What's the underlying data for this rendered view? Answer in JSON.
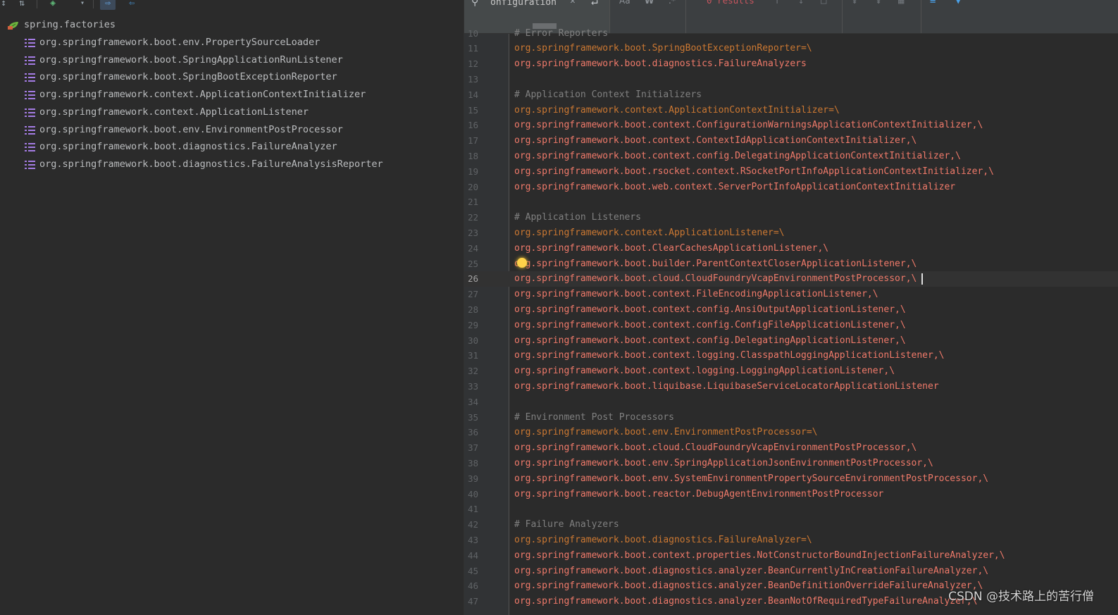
{
  "search": {
    "value": "onfiguration",
    "results": "0 results",
    "case_label": "Aa",
    "word_label": "W",
    "regex_label": ".*"
  },
  "tree": {
    "root": "spring.factories",
    "items": [
      "org.springframework.boot.env.PropertySourceLoader",
      "org.springframework.boot.SpringApplicationRunListener",
      "org.springframework.boot.SpringBootExceptionReporter",
      "org.springframework.context.ApplicationContextInitializer",
      "org.springframework.context.ApplicationListener",
      "org.springframework.boot.env.EnvironmentPostProcessor",
      "org.springframework.boot.diagnostics.FailureAnalyzer",
      "org.springframework.boot.diagnostics.FailureAnalysisReporter"
    ]
  },
  "editor": {
    "current_line": 26,
    "lines": [
      {
        "n": "10",
        "type": "comment",
        "text": "# Error Reporters"
      },
      {
        "n": "11",
        "type": "key",
        "text": "org.springframework.boot.SpringBootExceptionReporter=\\"
      },
      {
        "n": "12",
        "type": "value",
        "text": "org.springframework.boot.diagnostics.FailureAnalyzers"
      },
      {
        "n": "13",
        "type": "blank",
        "text": ""
      },
      {
        "n": "14",
        "type": "comment",
        "text": "# Application Context Initializers"
      },
      {
        "n": "15",
        "type": "key",
        "text": "org.springframework.context.ApplicationContextInitializer=\\"
      },
      {
        "n": "16",
        "type": "value",
        "text": "org.springframework.boot.context.ConfigurationWarningsApplicationContextInitializer,\\"
      },
      {
        "n": "17",
        "type": "value",
        "text": "org.springframework.boot.context.ContextIdApplicationContextInitializer,\\"
      },
      {
        "n": "18",
        "type": "value",
        "text": "org.springframework.boot.context.config.DelegatingApplicationContextInitializer,\\"
      },
      {
        "n": "19",
        "type": "value",
        "text": "org.springframework.boot.rsocket.context.RSocketPortInfoApplicationContextInitializer,\\"
      },
      {
        "n": "20",
        "type": "value",
        "text": "org.springframework.boot.web.context.ServerPortInfoApplicationContextInitializer"
      },
      {
        "n": "21",
        "type": "blank",
        "text": ""
      },
      {
        "n": "22",
        "type": "comment",
        "text": "# Application Listeners"
      },
      {
        "n": "23",
        "type": "key",
        "text": "org.springframework.context.ApplicationListener=\\"
      },
      {
        "n": "24",
        "type": "value",
        "text": "org.springframework.boot.ClearCachesApplicationListener,\\"
      },
      {
        "n": "25",
        "type": "value",
        "text": "org.springframework.boot.builder.ParentContextCloserApplicationListener,\\"
      },
      {
        "n": "26",
        "type": "value",
        "text": "org.springframework.boot.cloud.CloudFoundryVcapEnvironmentPostProcessor,\\"
      },
      {
        "n": "27",
        "type": "value",
        "text": "org.springframework.boot.context.FileEncodingApplicationListener,\\"
      },
      {
        "n": "28",
        "type": "value",
        "text": "org.springframework.boot.context.config.AnsiOutputApplicationListener,\\"
      },
      {
        "n": "29",
        "type": "value",
        "text": "org.springframework.boot.context.config.ConfigFileApplicationListener,\\"
      },
      {
        "n": "30",
        "type": "value",
        "text": "org.springframework.boot.context.config.DelegatingApplicationListener,\\"
      },
      {
        "n": "31",
        "type": "value",
        "text": "org.springframework.boot.context.logging.ClasspathLoggingApplicationListener,\\"
      },
      {
        "n": "32",
        "type": "value",
        "text": "org.springframework.boot.context.logging.LoggingApplicationListener,\\"
      },
      {
        "n": "33",
        "type": "value",
        "text": "org.springframework.boot.liquibase.LiquibaseServiceLocatorApplicationListener"
      },
      {
        "n": "34",
        "type": "blank",
        "text": ""
      },
      {
        "n": "35",
        "type": "comment",
        "text": "# Environment Post Processors"
      },
      {
        "n": "36",
        "type": "key",
        "text": "org.springframework.boot.env.EnvironmentPostProcessor=\\"
      },
      {
        "n": "37",
        "type": "value",
        "text": "org.springframework.boot.cloud.CloudFoundryVcapEnvironmentPostProcessor,\\"
      },
      {
        "n": "38",
        "type": "value",
        "text": "org.springframework.boot.env.SpringApplicationJsonEnvironmentPostProcessor,\\"
      },
      {
        "n": "39",
        "type": "value",
        "text": "org.springframework.boot.env.SystemEnvironmentPropertySourceEnvironmentPostProcessor,\\"
      },
      {
        "n": "40",
        "type": "value",
        "text": "org.springframework.boot.reactor.DebugAgentEnvironmentPostProcessor"
      },
      {
        "n": "41",
        "type": "blank",
        "text": ""
      },
      {
        "n": "42",
        "type": "comment",
        "text": "# Failure Analyzers"
      },
      {
        "n": "43",
        "type": "key",
        "text": "org.springframework.boot.diagnostics.FailureAnalyzer=\\"
      },
      {
        "n": "44",
        "type": "value",
        "text": "org.springframework.boot.context.properties.NotConstructorBoundInjectionFailureAnalyzer,\\"
      },
      {
        "n": "45",
        "type": "value",
        "text": "org.springframework.boot.diagnostics.analyzer.BeanCurrentlyInCreationFailureAnalyzer,\\"
      },
      {
        "n": "46",
        "type": "value",
        "text": "org.springframework.boot.diagnostics.analyzer.BeanDefinitionOverrideFailureAnalyzer,\\"
      },
      {
        "n": "47",
        "type": "value",
        "text": "org.springframework.boot.diagnostics.analyzer.BeanNotOfRequiredTypeFailureAnalyzer,\\"
      }
    ]
  },
  "watermark": "CSDN @技术路上的苦行僧",
  "colors": {
    "background": "#2b2b2b",
    "gutter": "#313335",
    "key": "#cc7832",
    "value": "#f07a6a",
    "comment": "#808080",
    "list_icon": "#a47ce4",
    "results_error": "#c7555e"
  }
}
